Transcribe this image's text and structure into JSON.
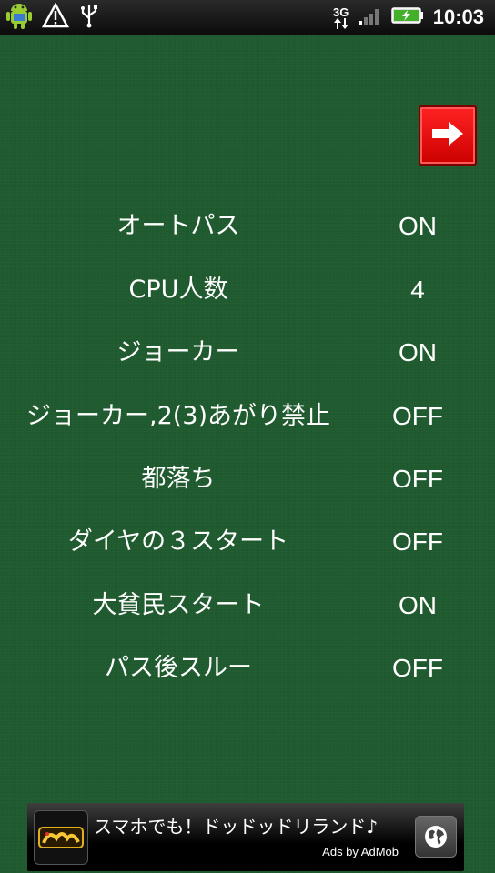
{
  "status_bar": {
    "icons": [
      "android-icon",
      "warning-icon",
      "usb-icon",
      "network-3g-icon",
      "signal-icon",
      "battery-charging-icon"
    ],
    "network_label": "3G",
    "time": "10:03"
  },
  "toolbar": {
    "next_icon": "arrow-right-icon",
    "accent": "#e01010"
  },
  "settings": [
    {
      "label": "オートパス",
      "value": "ON"
    },
    {
      "label": "CPU人数",
      "value": "4"
    },
    {
      "label": "ジョーカー",
      "value": "ON"
    },
    {
      "label": "ジョーカー,2(3)あがり禁止",
      "value": "OFF"
    },
    {
      "label": "都落ち",
      "value": "OFF"
    },
    {
      "label": "ダイヤの３スタート",
      "value": "OFF"
    },
    {
      "label": "大貧民スタート",
      "value": "ON"
    },
    {
      "label": "パス後スルー",
      "value": "OFF"
    }
  ],
  "ad": {
    "text": "スマホでも！ドッドッドリランド♪",
    "attribution": "Ads by AdMob",
    "logo_icon": "app-logo-icon",
    "globe_icon": "globe-icon"
  },
  "colors": {
    "felt": "#1f5a2e",
    "text": "#ffffff"
  }
}
